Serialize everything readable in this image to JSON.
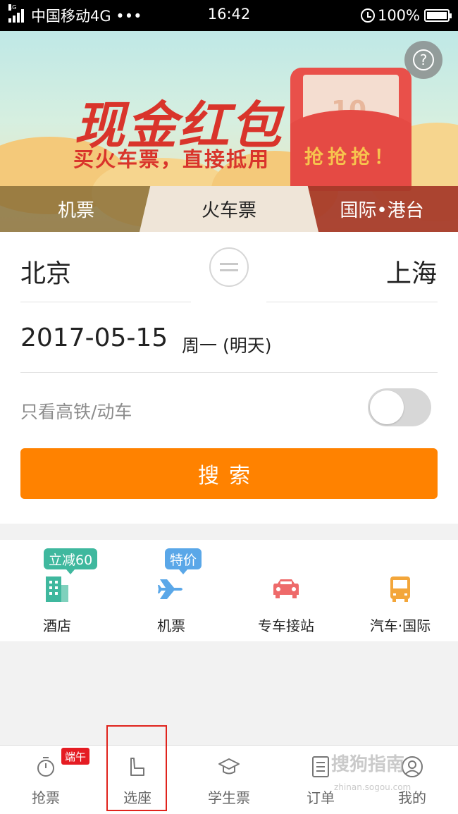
{
  "status_bar": {
    "carrier": "中国移动4G •••",
    "time": "16:42",
    "battery": "100%",
    "network_tag": "4G"
  },
  "banner": {
    "title": "现金红包",
    "subtitle": "买火车票，直接抵用",
    "envelope_cta": "抢抢抢！",
    "envelope_number": "10",
    "help_icon": "question-circle-icon"
  },
  "tabs": [
    {
      "label": "机票"
    },
    {
      "label": "火车票"
    },
    {
      "label": "国际•港台"
    }
  ],
  "search_form": {
    "from_city": "北京",
    "to_city": "上海",
    "date": "2017-05-15",
    "weekday": "周一 (明天)",
    "filter_label": "只看高铁/动车",
    "filter_on": false,
    "search_button": "搜索"
  },
  "services": [
    {
      "label": "酒店",
      "badge": "立减60",
      "badge_color": "#3fb89e",
      "icon": "hotel-building-icon",
      "icon_color": "#3fb89e"
    },
    {
      "label": "机票",
      "badge": "特价",
      "badge_color": "#5aa7e8",
      "icon": "airplane-icon",
      "icon_color": "#5aa7e8"
    },
    {
      "label": "专车接站",
      "badge": "",
      "icon": "car-icon",
      "icon_color": "#ee6a6a"
    },
    {
      "label": "汽车·国际",
      "badge": "",
      "icon": "bus-icon",
      "icon_color": "#f3a63a"
    }
  ],
  "bottom_nav": [
    {
      "label": "抢票",
      "badge": "端午",
      "icon": "stopwatch-icon"
    },
    {
      "label": "选座",
      "icon": "seat-icon"
    },
    {
      "label": "学生票",
      "icon": "graduation-cap-icon"
    },
    {
      "label": "订单",
      "icon": "list-icon"
    },
    {
      "label": "我的",
      "icon": "user-icon"
    }
  ],
  "watermark": {
    "text": "搜狗指南",
    "url": "zhinan.sogou.com"
  },
  "colors": {
    "accent": "#ff8200",
    "banner_red": "#d9342b",
    "badge_red": "#e51c23"
  }
}
